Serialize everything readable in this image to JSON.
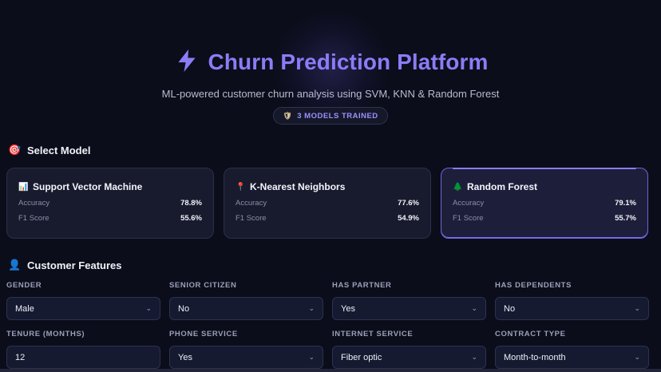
{
  "header": {
    "title": "Churn Prediction Platform",
    "subtitle": "ML-powered customer churn analysis using SVM, KNN & Random Forest",
    "badge": "3 MODELS TRAINED",
    "accent": "#8b7cf6"
  },
  "select_model": {
    "title": "Select Model",
    "icon": "target-icon",
    "models": [
      {
        "icon": "chart-icon",
        "glyph": "📊",
        "name": "Support Vector Machine",
        "accuracy_label": "Accuracy",
        "accuracy": "78.8%",
        "f1_label": "F1 Score",
        "f1": "55.6%",
        "selected": false
      },
      {
        "icon": "pin-icon",
        "glyph": "📍",
        "name": "K-Nearest Neighbors",
        "accuracy_label": "Accuracy",
        "accuracy": "77.6%",
        "f1_label": "F1 Score",
        "f1": "54.9%",
        "selected": false
      },
      {
        "icon": "tree-icon",
        "glyph": "🌲",
        "name": "Random Forest",
        "accuracy_label": "Accuracy",
        "accuracy": "79.1%",
        "f1_label": "F1 Score",
        "f1": "55.7%",
        "selected": true
      }
    ]
  },
  "features": {
    "title": "Customer Features",
    "icon": "person-icon",
    "fields": [
      {
        "label": "GENDER",
        "value": "Male"
      },
      {
        "label": "SENIOR CITIZEN",
        "value": "No"
      },
      {
        "label": "HAS PARTNER",
        "value": "Yes"
      },
      {
        "label": "HAS DEPENDENTS",
        "value": "No"
      },
      {
        "label": "TENURE (MONTHS)",
        "value": "12"
      },
      {
        "label": "PHONE SERVICE",
        "value": "Yes"
      },
      {
        "label": "INTERNET SERVICE",
        "value": "Fiber optic"
      },
      {
        "label": "CONTRACT TYPE",
        "value": "Month-to-month"
      }
    ]
  }
}
